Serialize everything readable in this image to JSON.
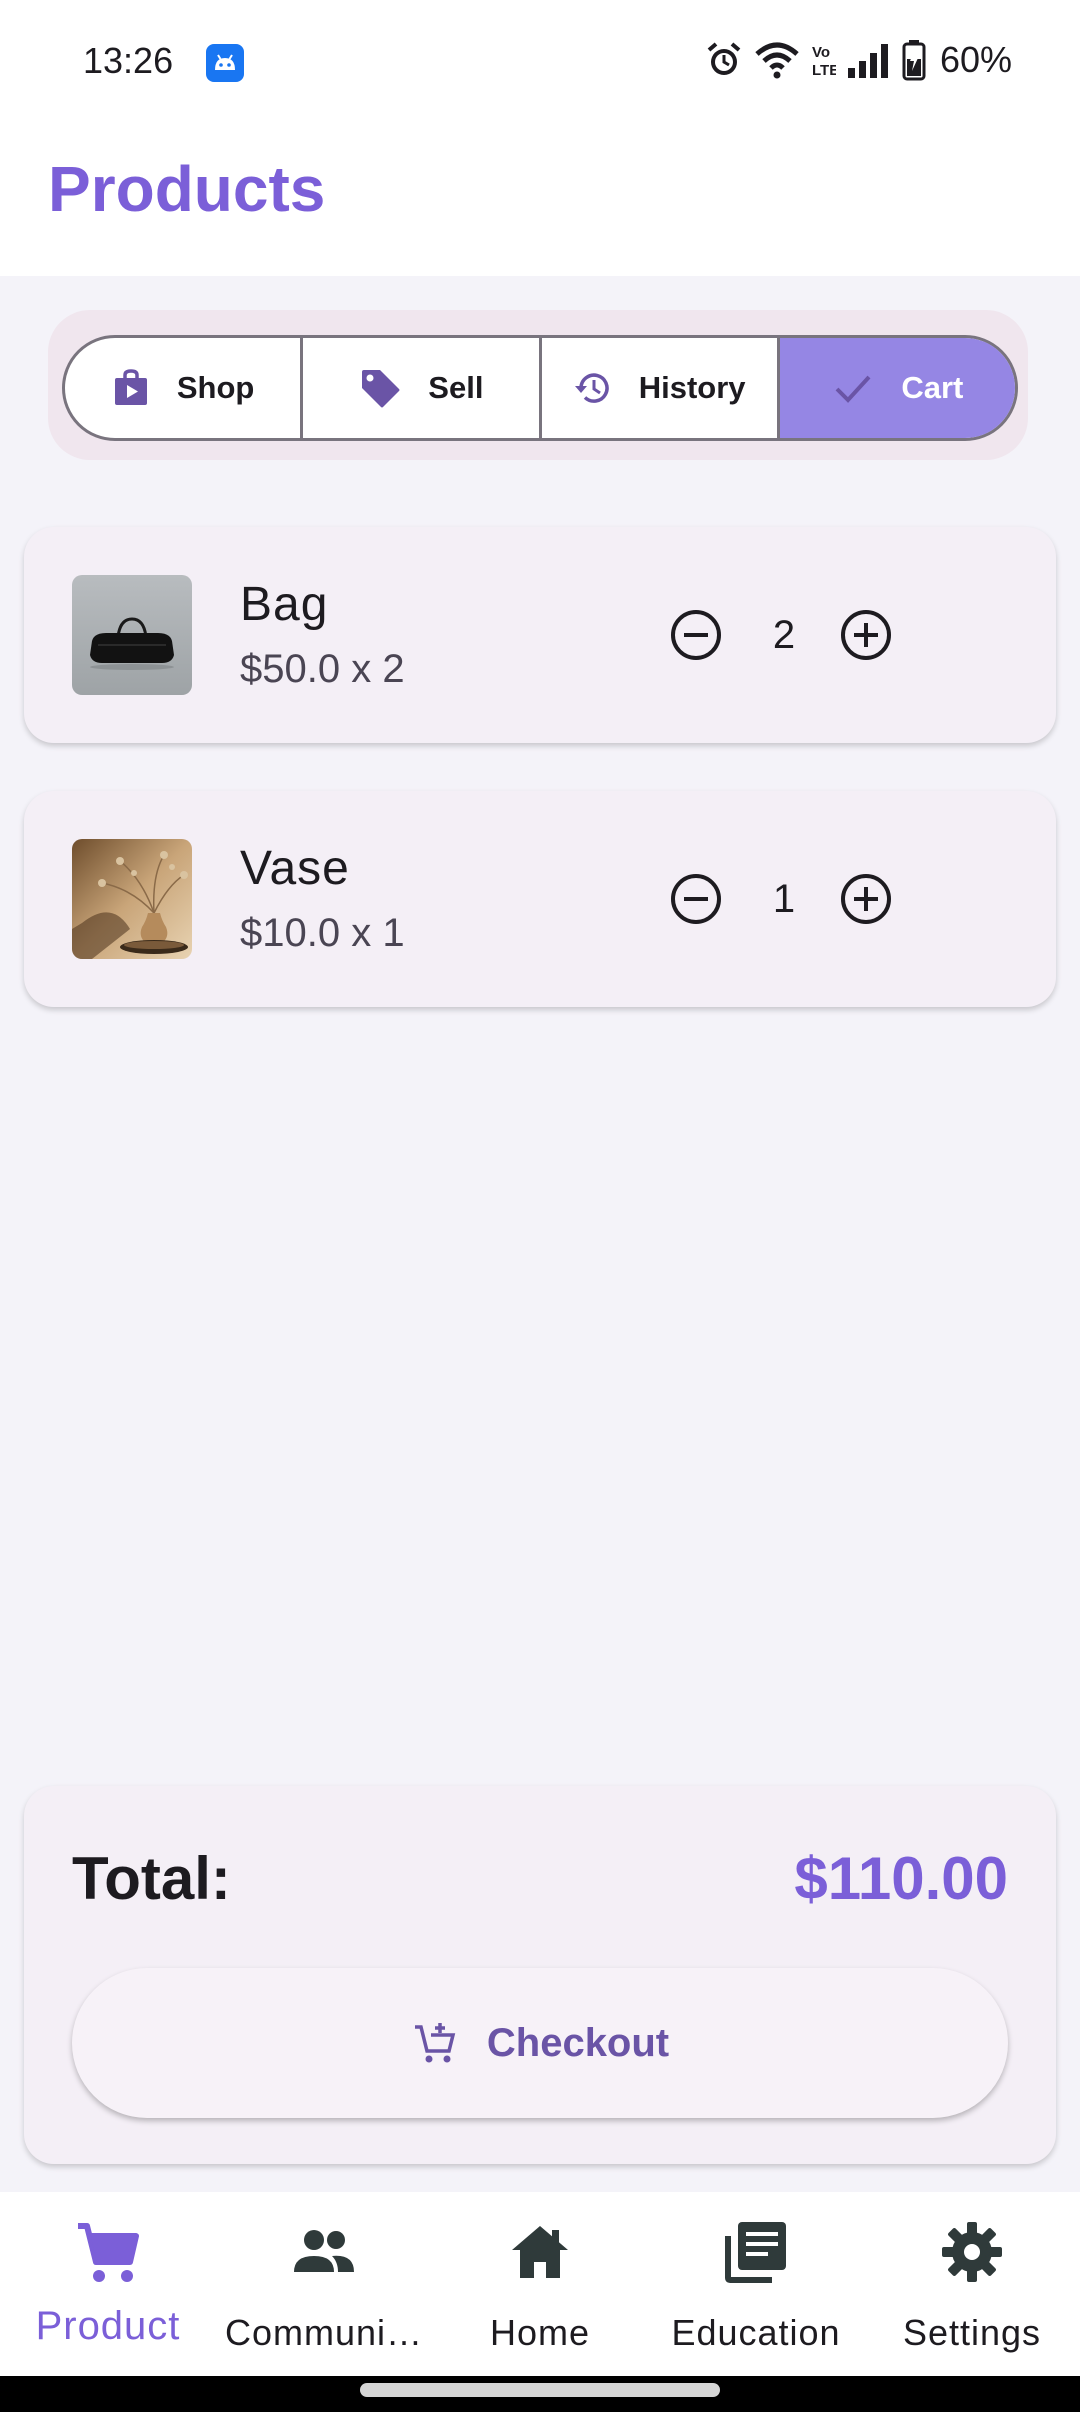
{
  "status_bar": {
    "time": "13:26",
    "battery": "60%"
  },
  "app_bar": {
    "title": "Products"
  },
  "segments": [
    {
      "label": "Shop",
      "icon": "shopping-bag-icon",
      "selected": false
    },
    {
      "label": "Sell",
      "icon": "tag-icon",
      "selected": false
    },
    {
      "label": "History",
      "icon": "history-icon",
      "selected": false
    },
    {
      "label": "Cart",
      "icon": "check-icon",
      "selected": true
    }
  ],
  "cart": {
    "items": [
      {
        "name": "Bag",
        "price_line": "$50.0 x 2",
        "quantity": "2",
        "image": "black-duffel-bag"
      },
      {
        "name": "Vase",
        "price_line": "$10.0 x 1",
        "quantity": "1",
        "image": "vase-with-dried-flowers"
      }
    ],
    "total_label": "Total:",
    "total_value": "$110.00",
    "checkout_label": "Checkout"
  },
  "bottom_nav": [
    {
      "label": "Product",
      "icon": "cart-icon",
      "active": true
    },
    {
      "label": "Communi…",
      "icon": "people-icon",
      "active": false
    },
    {
      "label": "Home",
      "icon": "home-icon",
      "active": false
    },
    {
      "label": "Education",
      "icon": "library-books-icon",
      "active": false
    },
    {
      "label": "Settings",
      "icon": "gear-icon",
      "active": false
    }
  ],
  "colors": {
    "accent": "#7b5fd8",
    "segment_selected": "#9586e4",
    "card_bg": "#f4eff6",
    "page_bg": "#f4f3f9"
  }
}
